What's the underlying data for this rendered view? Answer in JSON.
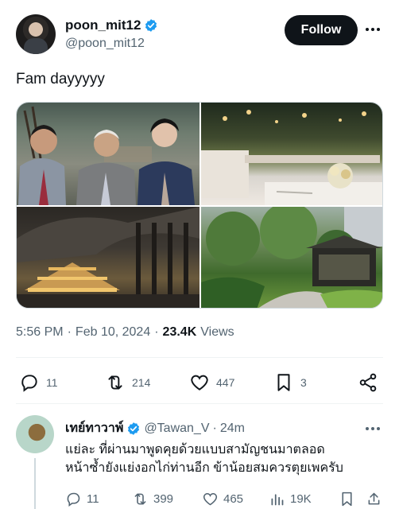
{
  "post": {
    "display_name": "poon_mit12",
    "handle": "@poon_mit12",
    "follow_label": "Follow",
    "text": "Fam dayyyyy",
    "time": "5:56 PM",
    "separator": "·",
    "date": "Feb 10, 2024",
    "views_count": "23.4K",
    "views_label": "Views",
    "media": [
      "photo-family-portrait",
      "photo-dinner-tables",
      "photo-building-interior",
      "photo-garden-pavilion"
    ],
    "stats": {
      "replies": "11",
      "reposts": "214",
      "likes": "447",
      "bookmarks": "3"
    }
  },
  "reply": {
    "display_name": "เทย์ทาวาพ์",
    "handle": "@Tawan_V",
    "separator": "·",
    "time": "24m",
    "text_line1": "แย่ละ ที่ผ่านมาพูดคุยด้วยแบบสามัญชนมาตลอด",
    "text_line2": "หน้าซ้ำยังแย่งอกไก่ท่านอีก ข้าน้อยสมควรตุยเพครับ",
    "stats": {
      "replies": "11",
      "reposts": "399",
      "likes": "465",
      "views": "19K"
    }
  },
  "colors": {
    "verified": "#1d9bf0",
    "primary_text": "#0f1419",
    "secondary_text": "#536471",
    "follow_bg": "#0f1419"
  },
  "icons": [
    "verified-badge-icon",
    "more-icon",
    "reply-icon",
    "repost-icon",
    "like-icon",
    "bookmark-icon",
    "share-icon",
    "views-icon"
  ]
}
